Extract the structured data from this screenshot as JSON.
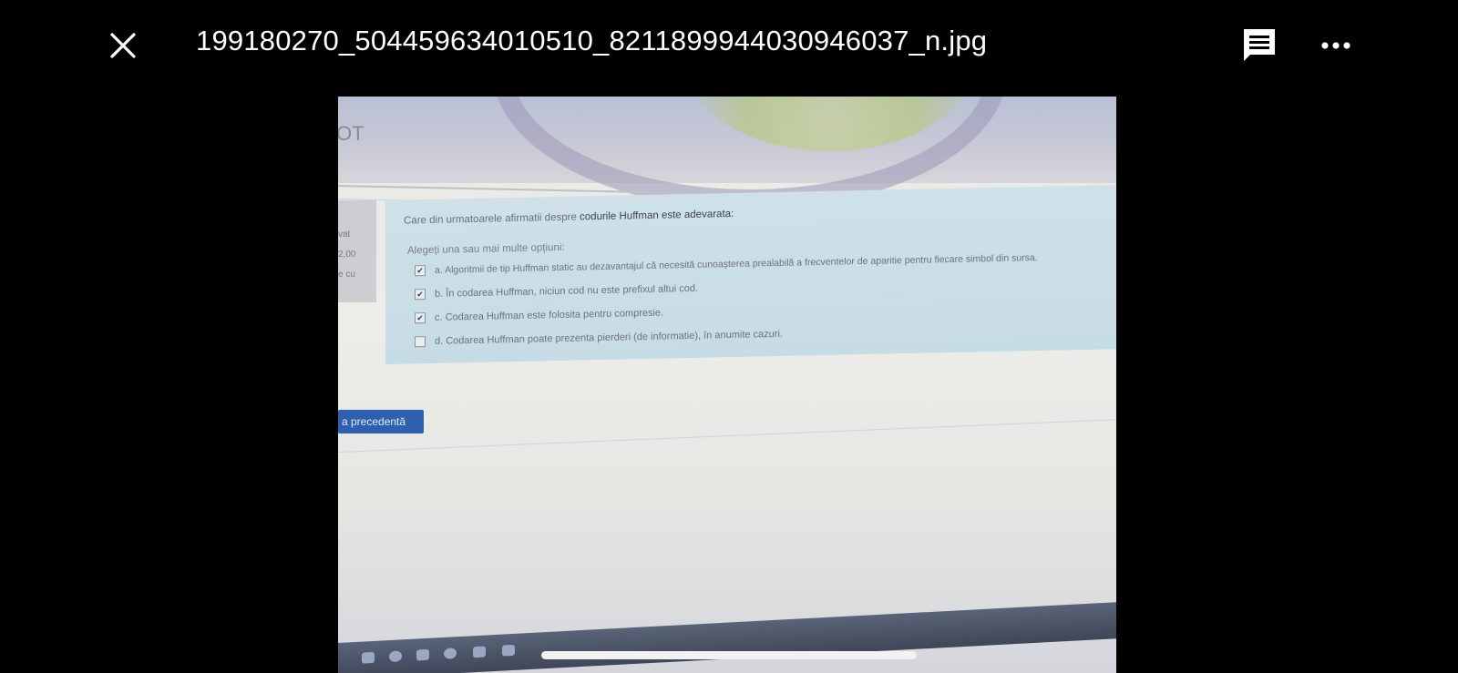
{
  "viewer": {
    "filename": "199180270_504459634010510_8211899944030946037_n.jpg",
    "icons": {
      "close": "close-icon",
      "comment": "comment-icon",
      "more": "more-options-icon"
    }
  },
  "photo": {
    "banner_text": "OT",
    "side_panel": [
      "vat",
      "2,00",
      "e cu"
    ],
    "question": {
      "prefix": "Care din urmatoarele afirmatii despre ",
      "emphasis": "codurile Huffman este adevarata:",
      "choose_label": "Alegeți una sau mai multe opțiuni:",
      "options": [
        {
          "text": "a. Algoritmii de tip Huffman static au dezavantajul că necesită cunoașterea prealabilă a frecventelor de aparitie pentru fiecare simbol din sursa.",
          "checked": true,
          "mark": "✔"
        },
        {
          "text": "b. În codarea Huffman, niciun cod nu este prefixul altui cod.",
          "checked": true,
          "mark": "✔"
        },
        {
          "text": "c. Codarea Huffman este folosita pentru compresie.",
          "checked": true,
          "mark": "✔"
        },
        {
          "text": "d. Codarea Huffman poate prezenta pierderi (de informatie), în anumite cazuri.",
          "checked": false,
          "mark": ""
        }
      ]
    },
    "prev_button_label": "a precedentă"
  }
}
